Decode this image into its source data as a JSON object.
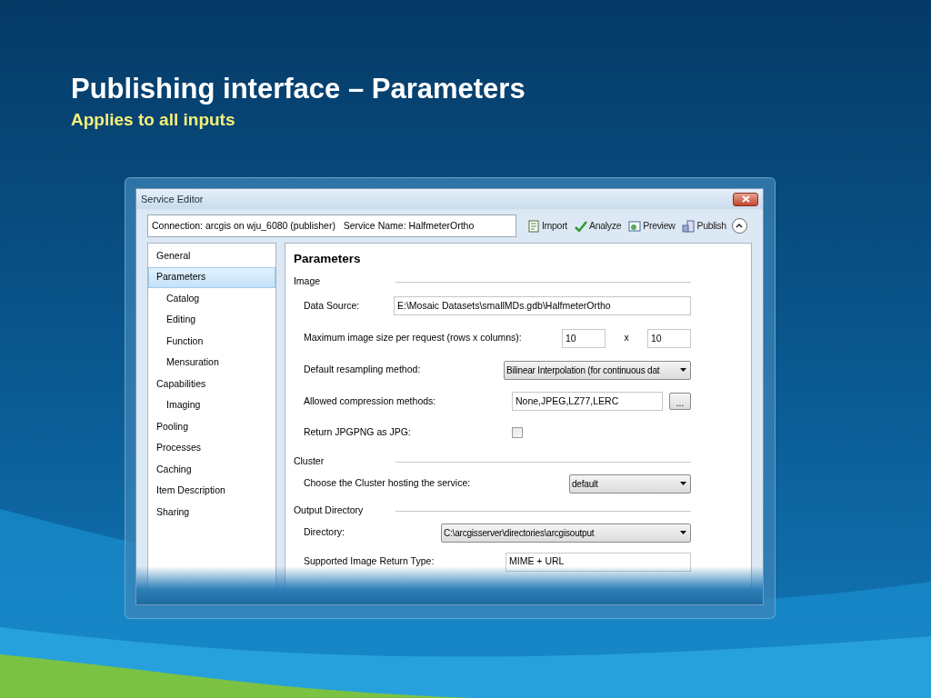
{
  "slide": {
    "title": "Publishing interface – Parameters",
    "subtitle": "Applies to all inputs"
  },
  "window": {
    "title": "Service Editor"
  },
  "connection": {
    "value": "Connection: arcgis on wju_6080 (publisher)   Service Name: HalfmeterOrtho"
  },
  "toolbar": [
    {
      "label": "Import"
    },
    {
      "label": "Analyze"
    },
    {
      "label": "Preview"
    },
    {
      "label": "Publish"
    }
  ],
  "sidebar": {
    "items": [
      {
        "label": "General",
        "selected": false
      },
      {
        "label": "Parameters",
        "selected": true,
        "children": [
          {
            "label": "Catalog",
            "selected": false
          },
          {
            "label": "Editing",
            "selected": false
          },
          {
            "label": "Function",
            "selected": false
          },
          {
            "label": "Mensuration",
            "selected": false
          }
        ]
      },
      {
        "label": "Capabilities",
        "selected": false,
        "children": [
          {
            "label": "Imaging",
            "selected": false
          }
        ]
      },
      {
        "label": "Pooling",
        "selected": false
      },
      {
        "label": "Processes",
        "selected": false
      },
      {
        "label": "Caching",
        "selected": false
      },
      {
        "label": "Item Description",
        "selected": false
      },
      {
        "label": "Sharing",
        "selected": false
      }
    ]
  },
  "panel": {
    "heading": "Parameters",
    "sections": [
      {
        "title": "Image",
        "rows": [
          {
            "kind": "text",
            "label": "Data Source:",
            "value": "E:\\Mosaic Datasets\\smallMDs.gdb\\HalfmeterOrtho"
          },
          {
            "kind": "size",
            "label": "Maximum image size per request (rows x columns):",
            "rows": "10",
            "separator": "x",
            "columns": "10"
          },
          {
            "kind": "dropdown",
            "label": "Default resampling method:",
            "value": "Bilinear Interpolation (for continuous dat"
          },
          {
            "kind": "browse",
            "label": "Allowed compression methods:",
            "value": "None,JPEG,LZ77,LERC",
            "button": "..."
          },
          {
            "kind": "checkbox",
            "label": "Return JPGPNG as JPG:",
            "checked": false
          }
        ]
      },
      {
        "title": "Cluster",
        "rows": [
          {
            "kind": "dropdown",
            "label": "Choose the Cluster hosting the service:",
            "value": "default"
          }
        ]
      },
      {
        "title": "Output Directory",
        "rows": [
          {
            "kind": "dropdown",
            "label": "Directory:",
            "value": "C:\\arcgisserver\\directories\\arcgisoutput"
          },
          {
            "kind": "text",
            "label": "Supported Image Return Type:",
            "value": "MIME + URL"
          }
        ]
      }
    ]
  }
}
